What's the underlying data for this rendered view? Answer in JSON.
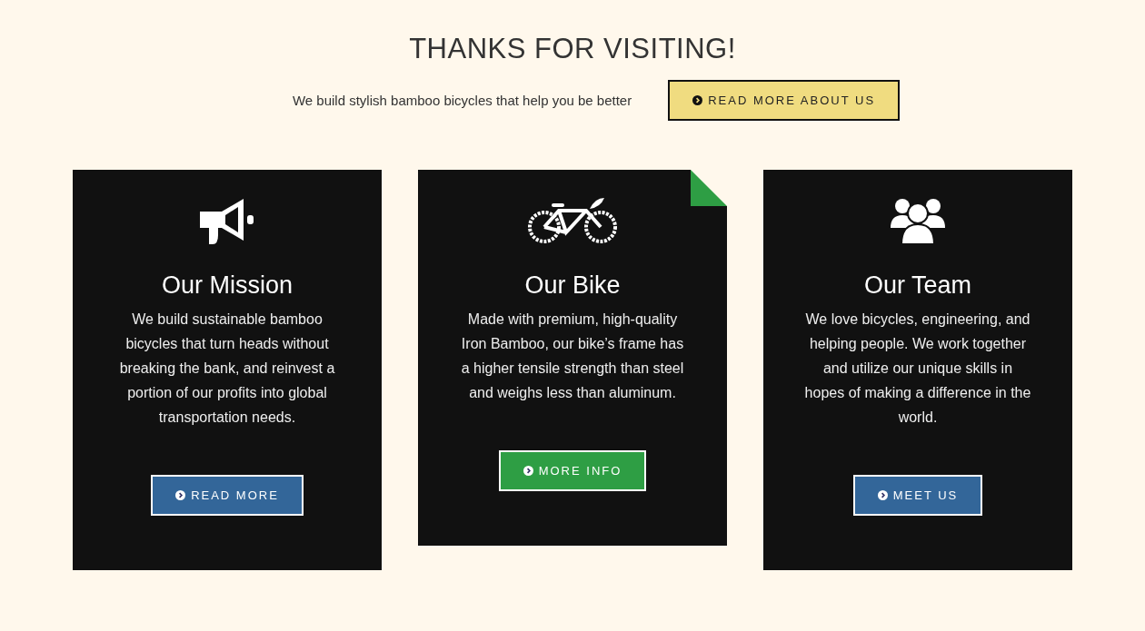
{
  "header": {
    "title": "THANKS FOR VISITING!",
    "tagline": "We build stylish bamboo bicycles that help you be better",
    "button": "READ MORE ABOUT US"
  },
  "cards": [
    {
      "kind": "megaphone",
      "title": "Our Mission",
      "text": "We build sustainable bamboo bicycles that turn heads without breaking the bank, and reinvest a portion of our profits into global transportation needs.",
      "button": "READ MORE",
      "color": "#336699",
      "folded_corner": false
    },
    {
      "kind": "bike",
      "title": "Our Bike",
      "text": "Made with premium, high-quality Iron Bamboo, our bike’s frame has a higher tensile strength than steel and weighs less than aluminum.",
      "button": "MORE INFO",
      "color": "#2e9e44",
      "folded_corner": true
    },
    {
      "kind": "team",
      "title": "Our Team",
      "text": "We love bicycles, engineering, and helping people. We work together and utilize our unique skills in hopes of making a difference in the world.",
      "button": "MEET US",
      "color": "#336699",
      "folded_corner": false
    }
  ]
}
